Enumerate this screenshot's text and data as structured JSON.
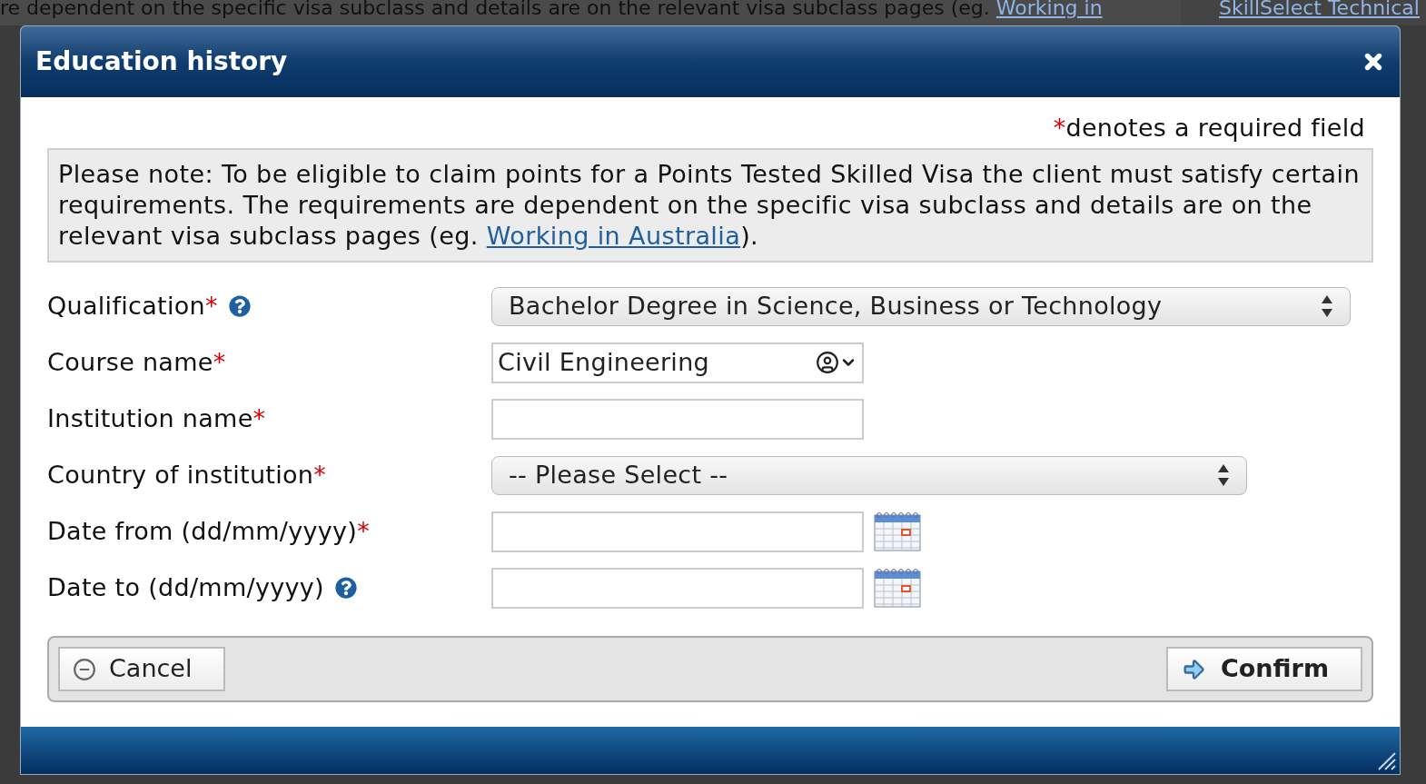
{
  "background": {
    "text": "re dependent on the specific visa subclass and details are on the relevant visa subclass pages (eg. ",
    "link": "Working in",
    "side_link": "SkillSelect Technical"
  },
  "dialog": {
    "title": "Education history",
    "required_note": {
      "mark": "*",
      "text": "denotes a required field"
    },
    "notice": {
      "text_before": "Please note: To be eligible to claim points for a Points Tested Skilled Visa the client must satisfy certain requirements. The requirements are dependent on the specific visa subclass and details are on the relevant visa subclass pages (eg. ",
      "link": "Working in Australia",
      "text_after": ")."
    },
    "fields": [
      {
        "kind": "select",
        "label": "Qualification",
        "required_mark": "*",
        "help": true,
        "value": "Bachelor Degree in Science, Business or Technology"
      },
      {
        "kind": "text",
        "label": "Course name",
        "required_mark": "*",
        "help": false,
        "value": "Civil Engineering",
        "autofill": true
      },
      {
        "kind": "text",
        "label": "Institution name",
        "required_mark": "*",
        "help": false
      },
      {
        "kind": "select",
        "label": "Country of institution",
        "required_mark": "*",
        "help": false,
        "value": "-- Please Select --"
      },
      {
        "kind": "date",
        "label": "Date from (dd/mm/yyyy)",
        "required_mark": "*",
        "help": false
      },
      {
        "kind": "date",
        "label": "Date to (dd/mm/yyyy)",
        "help": true
      }
    ],
    "buttons": [
      {
        "kind": "cancel",
        "label": "Cancel"
      },
      {
        "kind": "confirm",
        "label": "Confirm"
      }
    ]
  }
}
